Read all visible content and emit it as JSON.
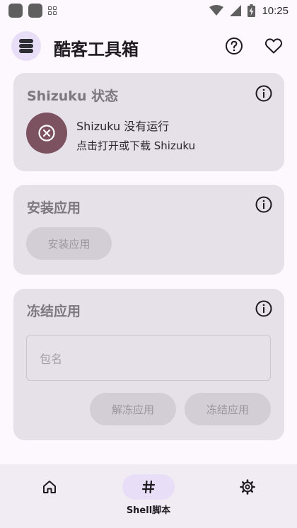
{
  "status_bar": {
    "time": "10:25",
    "icons": [
      "app-notification-icon",
      "app-notification-icon",
      "grid-icon",
      "wifi-icon",
      "signal-icon",
      "battery-charging-icon"
    ]
  },
  "app_bar": {
    "title": "酷客工具箱",
    "logo_icon": "stack-layers-icon",
    "actions": [
      "help-icon",
      "favorite-icon"
    ]
  },
  "shizuku_card": {
    "title": "Shizuku 状态",
    "status_text": "Shizuku 没有运行",
    "hint_text": "点击打开或下载 Shizuku",
    "status_icon": "error-circle-icon",
    "status_color": "#7d5260"
  },
  "install_card": {
    "title": "安装应用",
    "button_label": "安装应用"
  },
  "freeze_card": {
    "title": "冻结应用",
    "package_field_placeholder": "包名",
    "unfreeze_label": "解冻应用",
    "freeze_label": "冻结应用"
  },
  "bottom_nav": {
    "items": [
      {
        "icon": "home-icon",
        "label": "",
        "active": false
      },
      {
        "icon": "hash-icon",
        "label": "Shell脚本",
        "active": true
      },
      {
        "icon": "settings-icon",
        "label": "",
        "active": false
      }
    ]
  },
  "colors": {
    "card_background": "#e6e0e8",
    "active_indicator": "#e8def8",
    "error_circle": "#7d5260"
  }
}
